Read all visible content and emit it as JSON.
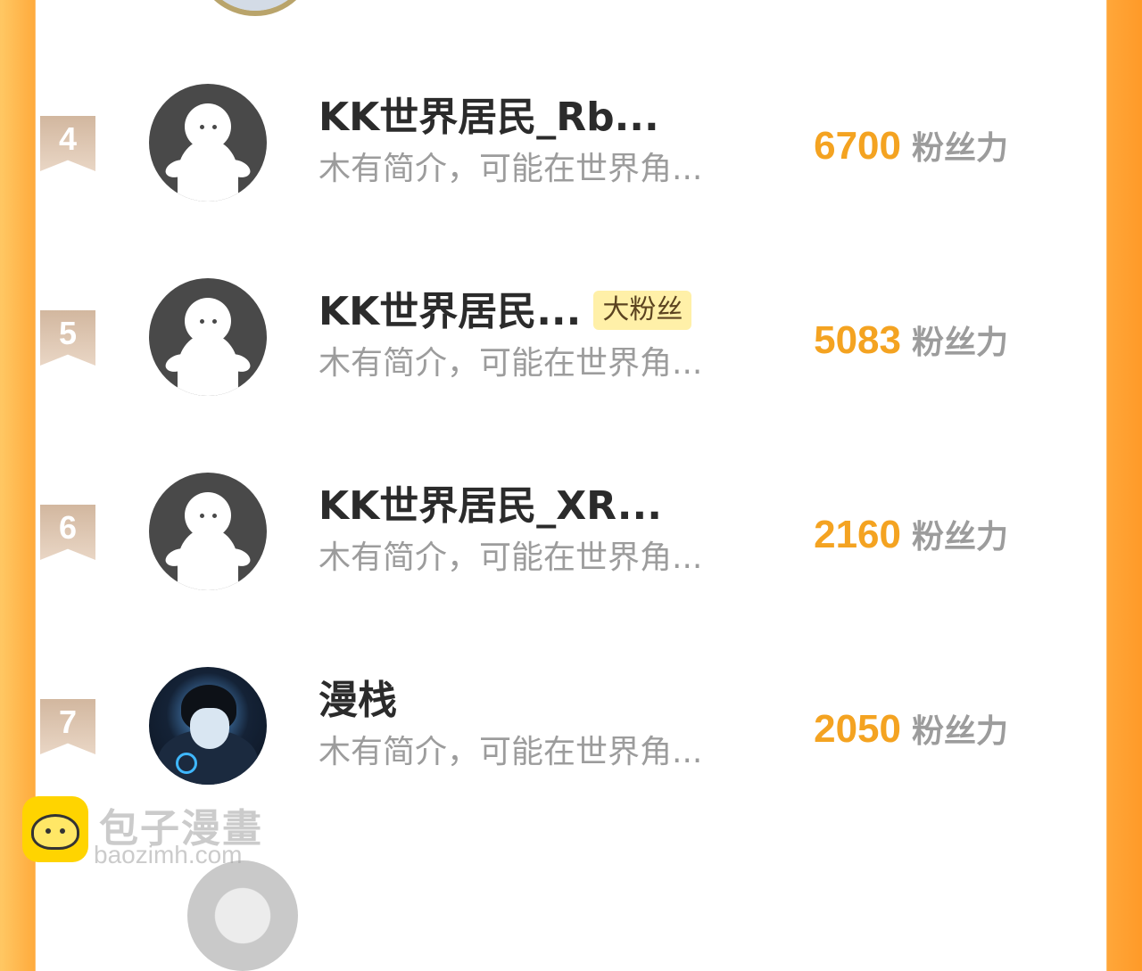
{
  "ranking": [
    {
      "rank": "4",
      "name": "KK世界居民_Rb...",
      "badge": "",
      "desc": "木有简介，可能在世界角...",
      "fans": "6700",
      "unit": "粉丝力",
      "avatar": "default-avatar"
    },
    {
      "rank": "5",
      "name": "KK世界居民...",
      "badge": "大粉丝",
      "desc": "木有简介，可能在世界角...",
      "fans": "5083",
      "unit": "粉丝力",
      "avatar": "default-avatar"
    },
    {
      "rank": "6",
      "name": "KK世界居民_XR...",
      "badge": "",
      "desc": "木有简介，可能在世界角...",
      "fans": "2160",
      "unit": "粉丝力",
      "avatar": "default-avatar"
    },
    {
      "rank": "7",
      "name": "漫栈",
      "badge": "",
      "desc": "木有简介，可能在世界角...",
      "fans": "2050",
      "unit": "粉丝力",
      "avatar": "photo-avatar"
    }
  ],
  "watermark": {
    "title": "包子漫畫",
    "url": "baozimh.com"
  },
  "colors": {
    "accent": "#f4a321",
    "badge_bg": "#fff0a8",
    "rank_bg": "#d2b79f",
    "side_orange": "#ffa73a"
  }
}
